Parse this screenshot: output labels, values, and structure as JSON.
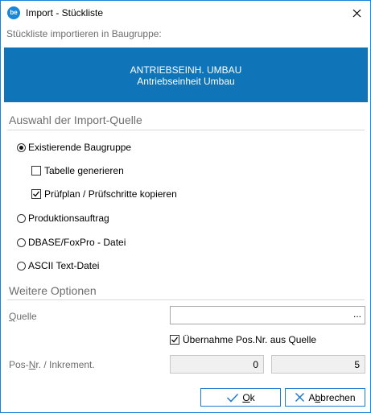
{
  "window": {
    "title": "Import - Stückliste",
    "app_icon_text": "be"
  },
  "subtitle": "Stückliste importieren in Baugruppe:",
  "banner": {
    "line1": "ANTRIEBSEINH. UMBAU",
    "line2": "Antriebseinheit Umbau"
  },
  "sections": {
    "source_title": "Auswahl der Import-Quelle",
    "options_title": "Weitere Optionen"
  },
  "source_options": {
    "existing": {
      "label": "Existierende Baugruppe",
      "selected": true
    },
    "generate_table": {
      "label": "Tabelle generieren",
      "checked": false
    },
    "copy_testplan": {
      "label": "Prüfplan / Prüfschritte kopieren",
      "checked": true
    },
    "production_order": {
      "label": "Produktionsauftrag",
      "selected": false
    },
    "dbase": {
      "label": "DBASE/FoxPro - Datei",
      "selected": false
    },
    "ascii": {
      "label": "ASCII Text-Datei",
      "selected": false
    }
  },
  "options": {
    "source_label_first": "Q",
    "source_label_rest": "uelle",
    "source_value": "",
    "browse_label": "...",
    "take_pos": {
      "label": "Übernahme Pos.Nr. aus Quelle",
      "checked": true
    },
    "pos_label_a": "Pos-",
    "pos_label_u": "N",
    "pos_label_b": "r. / Inkrement.",
    "pos_value": "0",
    "increment_value": "5"
  },
  "buttons": {
    "ok_u": "O",
    "ok_rest": "k",
    "cancel_pre": "A",
    "cancel_u": "b",
    "cancel_rest": "brechen"
  }
}
